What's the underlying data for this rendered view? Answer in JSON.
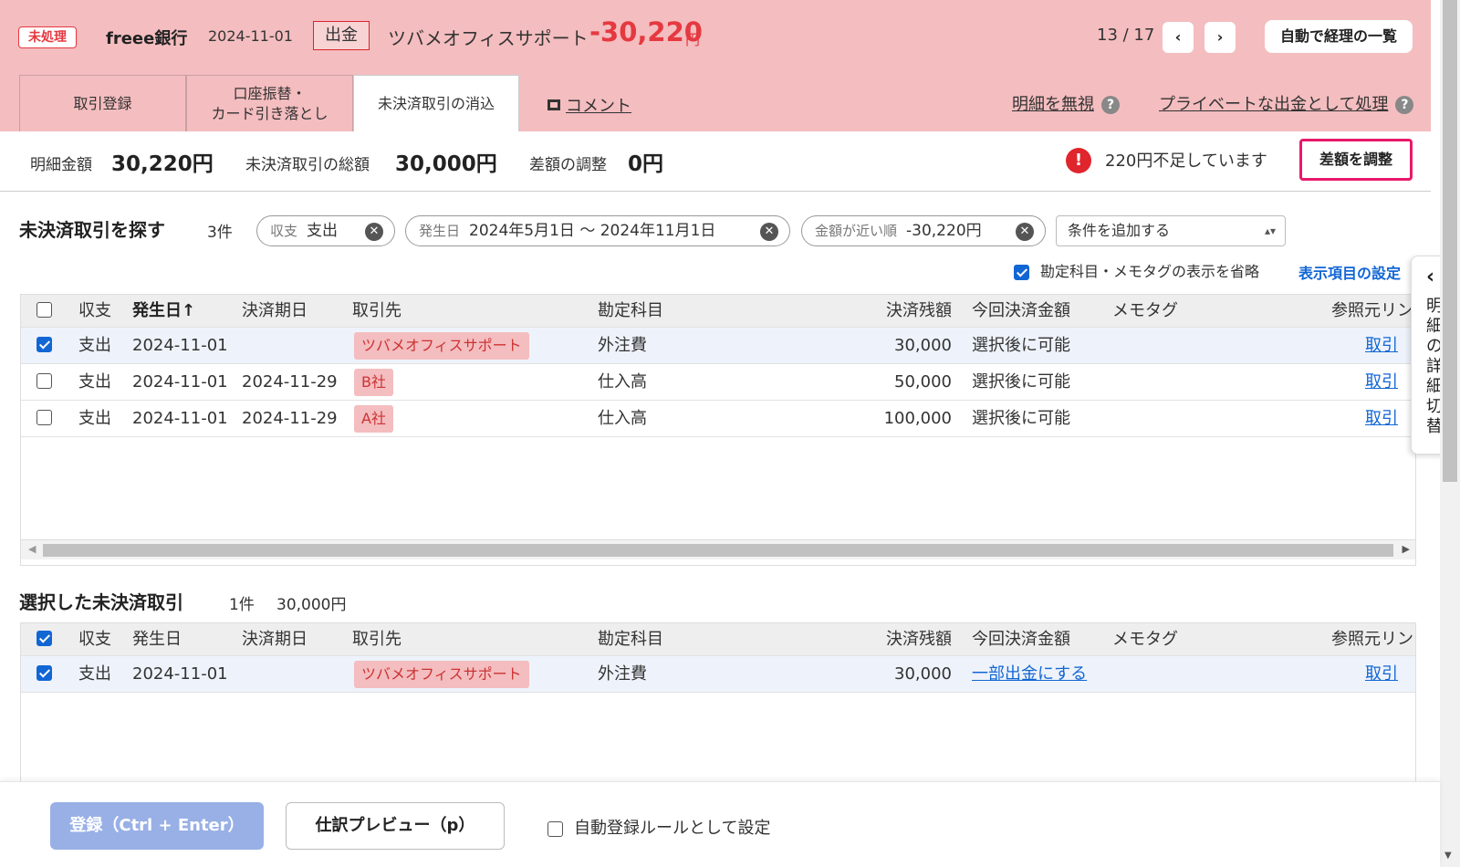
{
  "header": {
    "status_badge": "未処理",
    "bank": "freee銀行",
    "date": "2024-11-01",
    "direction": "出金",
    "partner": "ツバメオフィスサポート",
    "amount": "-30,220",
    "currency": "円",
    "pager": "13 / 17",
    "prev_icon": "‹",
    "next_icon": "›",
    "list_button": "自動で経理の一覧"
  },
  "tabs": [
    {
      "label": "取引登録"
    },
    {
      "label": "口座振替・\nカード引き落とし"
    },
    {
      "label": "未決済取引の消込"
    }
  ],
  "comment_link": "コメント",
  "ignore_link": "明細を無視",
  "private_link": "プライベートな出金として処理",
  "help_icon": "?",
  "summary": {
    "detail_label": "明細金額",
    "detail_value": "30,220円",
    "unsettled_label": "未決済取引の総額",
    "unsettled_value": "30,000円",
    "adjust_label": "差額の調整",
    "adjust_value": "0円",
    "warning_icon": "!",
    "warning": "220円不足しています",
    "adjust_button": "差額を調整"
  },
  "search": {
    "title": "未決済取引を探す",
    "count": "3件",
    "chips": [
      {
        "key": "収支",
        "value": "支出"
      },
      {
        "key": "発生日",
        "value": "2024年5月1日 〜 2024年11月1日"
      },
      {
        "key": "金額が近い順",
        "value": "-30,220円"
      }
    ],
    "chip_clear_icon": "✕",
    "add_condition": "条件を追加する",
    "select_arrow": "▴▾",
    "omit_label": "勘定科目・メモタグの表示を省略",
    "display_settings": "表示項目の設定"
  },
  "columns": {
    "type": "収支",
    "date": "発生日",
    "date_sorted": "発生日↑",
    "due": "決済期日",
    "partner": "取引先",
    "account": "勘定科目",
    "balance": "決済残額",
    "pay_amount": "今回決済金額",
    "memo": "メモタグ",
    "ref": "参照元リンク"
  },
  "results": [
    {
      "checked": true,
      "type": "支出",
      "date": "2024-11-01",
      "due": "",
      "partner": "ツバメオフィスサポート",
      "account": "外注費",
      "balance": "30,000",
      "pay_amount": "選択後に可能",
      "memo": "",
      "ref": "取引"
    },
    {
      "checked": false,
      "type": "支出",
      "date": "2024-11-01",
      "due": "2024-11-29",
      "partner": "B社",
      "account": "仕入高",
      "balance": "50,000",
      "pay_amount": "選択後に可能",
      "memo": "",
      "ref": "取引"
    },
    {
      "checked": false,
      "type": "支出",
      "date": "2024-11-01",
      "due": "2024-11-29",
      "partner": "A社",
      "account": "仕入高",
      "balance": "100,000",
      "pay_amount": "選択後に可能",
      "memo": "",
      "ref": "取引"
    }
  ],
  "selected": {
    "title": "選択した未決済取引",
    "count": "1件",
    "total": "30,000円",
    "rows": [
      {
        "checked": true,
        "type": "支出",
        "date": "2024-11-01",
        "due": "",
        "partner": "ツバメオフィスサポート",
        "account": "外注費",
        "balance": "30,000",
        "pay_amount": "一部出金にする",
        "memo": "",
        "ref": "取引"
      }
    ]
  },
  "side_panel": {
    "chevron": "‹",
    "label": "明細の詳細切替"
  },
  "footer": {
    "register": "登録（Ctrl + Enter）",
    "preview": "仕訳プレビュー（p）",
    "auto_rule": "自動登録ルールとして設定"
  },
  "colors": {
    "header_bg": "#f4bdbf",
    "amount_red": "#e53940",
    "link_blue": "#1266d4",
    "highlight_pink": "#e8186b",
    "register_btn": "#98b0e6"
  }
}
